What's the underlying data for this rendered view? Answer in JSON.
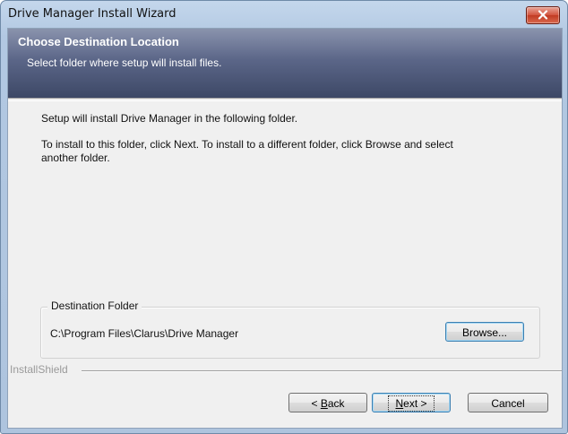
{
  "window": {
    "title": "Drive Manager Install Wizard"
  },
  "header": {
    "title": "Choose Destination Location",
    "subtitle": "Select folder where setup will install files."
  },
  "body": {
    "line1": "Setup will install Drive Manager in the following folder.",
    "line2a": "To install to this folder, click Next. To install to a different folder, click Browse and select",
    "line2b": "another folder."
  },
  "destination": {
    "group_label": "Destination Folder",
    "path": "C:\\Program Files\\Clarus\\Drive Manager",
    "browse_label": "Browse..."
  },
  "footer": {
    "brand": "InstallShield",
    "back_prefix": "< ",
    "back_mnemonic": "B",
    "back_rest": "ack",
    "next_mnemonic": "N",
    "next_rest": "ext >",
    "cancel_label": "Cancel"
  },
  "icons": {
    "close": "close-icon"
  },
  "colors": {
    "header_dark": "#3d4866",
    "header_light": "#8a93ad",
    "close_red": "#c13a22",
    "default_button_border": "#3c7fb1",
    "dialog_bg": "#f0f0f0"
  }
}
